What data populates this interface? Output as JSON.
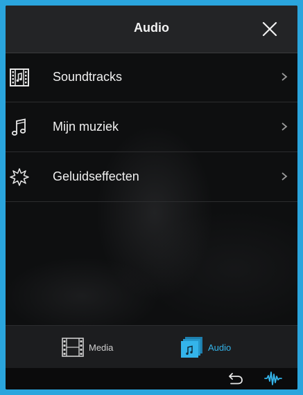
{
  "header": {
    "title": "Audio",
    "close_icon": "close-icon"
  },
  "menu": {
    "items": [
      {
        "label": "Soundtracks",
        "icon": "film-music-icon"
      },
      {
        "label": "Mijn muziek",
        "icon": "music-note-icon"
      },
      {
        "label": "Geluidseffecten",
        "icon": "burst-icon"
      }
    ]
  },
  "tabs": [
    {
      "label": "Media",
      "icon": "film-strip-icon",
      "active": false
    },
    {
      "label": "Audio",
      "icon": "audio-library-icon",
      "active": true
    }
  ],
  "bottom": {
    "back_icon": "back-arrow-icon",
    "wave_icon": "waveform-icon"
  },
  "colors": {
    "accent": "#34b4ea",
    "frame": "#2aa5dd",
    "header_bg": "#232426"
  }
}
